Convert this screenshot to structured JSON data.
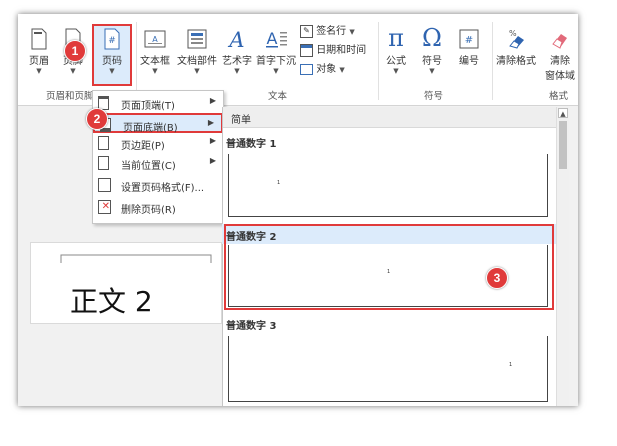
{
  "ribbon": {
    "buttons": [
      {
        "id": "header",
        "label": "页眉",
        "icon": "header-icon"
      },
      {
        "id": "footer",
        "label": "页脚",
        "icon": "footer-icon"
      },
      {
        "id": "page-number",
        "label": "页码",
        "icon": "page-number-icon"
      },
      {
        "id": "textbox",
        "label": "文本框",
        "icon": "textbox-icon"
      },
      {
        "id": "quickparts",
        "label": "文档部件",
        "icon": "quick-parts-icon"
      },
      {
        "id": "wordart",
        "label": "艺术字",
        "icon": "wordart-icon"
      },
      {
        "id": "dropcap",
        "label": "首字下沉",
        "icon": "dropcap-icon"
      },
      {
        "id": "equation",
        "label": "公式",
        "icon": "equation-icon"
      },
      {
        "id": "symbol",
        "label": "符号",
        "icon": "symbol-icon"
      },
      {
        "id": "numbering",
        "label": "编号",
        "icon": "numbering-icon"
      },
      {
        "id": "clearformat",
        "label": "清除格式",
        "icon": "clear-format-icon"
      },
      {
        "id": "clearfield",
        "label": "清除",
        "label2": "窗体域",
        "icon": "eraser-icon"
      }
    ],
    "small": {
      "signature": "签名行",
      "datetime": "日期和时间",
      "object": "对象"
    },
    "groups": {
      "header_footer": "页眉和页脚",
      "text": "文本",
      "symbols": "符号",
      "format": "格式"
    }
  },
  "menu": {
    "items": [
      {
        "label": "页面顶端(T)",
        "arrow": "▶",
        "icon": "page-top-icon"
      },
      {
        "label": "页面底端(B)",
        "arrow": "▶",
        "icon": "page-bottom-icon",
        "selected": true
      },
      {
        "label": "页边距(P)",
        "arrow": "▶",
        "icon": "page-margin-icon"
      },
      {
        "label": "当前位置(C)",
        "arrow": "▶",
        "icon": "current-position-icon"
      },
      {
        "label": "设置页码格式(F)...",
        "arrow": "",
        "icon": "format-page-number-icon"
      },
      {
        "label": "删除页码(R)",
        "arrow": "",
        "icon": "remove-page-number-icon"
      }
    ]
  },
  "gallery": {
    "section": "简单",
    "items": [
      {
        "title": "普通数字 1",
        "sample": "1"
      },
      {
        "title": "普通数字 2",
        "sample": "1"
      },
      {
        "title": "普通数字 3",
        "sample": "1"
      }
    ]
  },
  "steps": [
    "1",
    "2",
    "3"
  ],
  "document": {
    "text": "正文 2"
  },
  "colors": {
    "accent": "#e03a3a",
    "selection": "#dcebfb",
    "gallery_header": "#eeeeee"
  }
}
